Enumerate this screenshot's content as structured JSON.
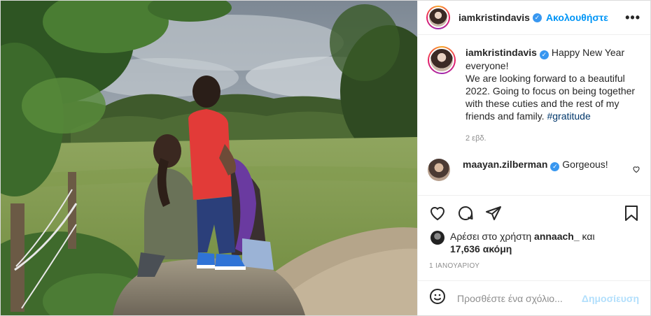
{
  "header": {
    "username": "iamkristindavis",
    "follow_label": "Ακολουθήστε",
    "more_label": "•••"
  },
  "caption": {
    "username": "iamkristindavis",
    "text_1": "Happy New Year everyone!",
    "text_2": "We are looking forward to a beautiful 2022. Going to focus on being together with these cuties and the rest of my friends and family.",
    "hashtag": "#gratitude",
    "time": "2 εβδ."
  },
  "comment": {
    "username": "maayan.zilberman",
    "text": "Gorgeous!"
  },
  "likes": {
    "prefix": "Αρέσει στο χρήστη",
    "user": "annaach_",
    "joiner": "και",
    "count": "17,636 ακόμη"
  },
  "date": "1 ΙΑΝΟΥΑΡΙΟΥ",
  "add_comment": {
    "placeholder": "Προσθέστε ένα σχόλιο...",
    "post_label": "Δημοσίευση"
  },
  "icons": {
    "verified": "verified-badge",
    "like": "heart-icon",
    "comment": "comment-icon",
    "share": "share-icon",
    "save": "bookmark-icon",
    "emoji": "emoji-icon"
  },
  "colors": {
    "accent": "#0095f6",
    "verified": "#3897f0",
    "hashtag": "#00376b",
    "post_disabled": "#b2dffc",
    "muted": "#8e8e8e"
  }
}
